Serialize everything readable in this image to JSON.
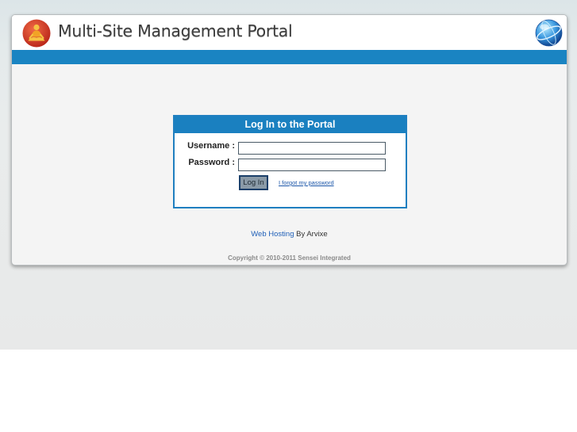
{
  "header": {
    "title": "Multi-Site Management Portal",
    "logo_icon": "meditating-figure-icon",
    "globe_icon": "globe-icon"
  },
  "login": {
    "title": "Log In to the Portal",
    "username_label": "Username :",
    "username_value": "",
    "password_label": "Password :",
    "password_value": "",
    "login_button": "Log In",
    "forgot_link": "I forgot my password"
  },
  "footer": {
    "hosting_link": "Web Hosting",
    "hosting_suffix": " By Arvixe",
    "copyright": "Copyright © 2010-2011 Sensei Integrated"
  },
  "colors": {
    "accent_blue": "#1a84c2",
    "logo_red": "#d23a25",
    "logo_gold": "#f0a020"
  }
}
